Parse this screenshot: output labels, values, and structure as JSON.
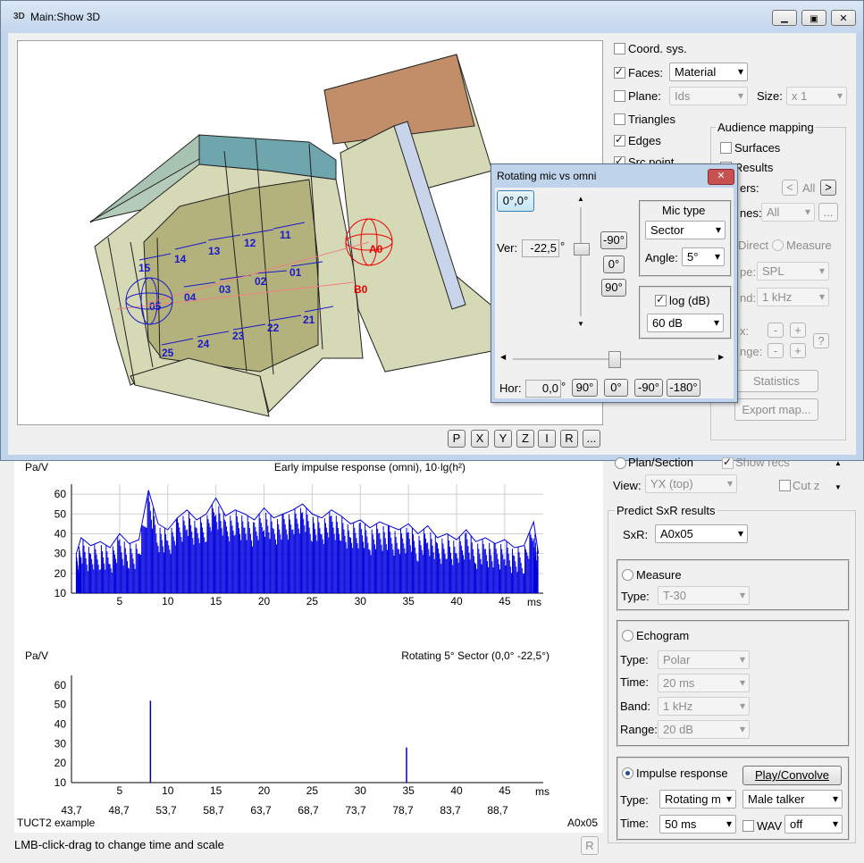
{
  "window": {
    "title": "Main:Show 3D",
    "icon": "3D"
  },
  "right_panel": {
    "coord_sys": "Coord. sys.",
    "faces": "Faces:",
    "faces_value": "Material",
    "plane": "Plane:",
    "plane_value": "Ids",
    "size": "Size:",
    "size_value": "x 1",
    "triangles": "Triangles",
    "edges": "Edges",
    "src_point_partial": "Src.point",
    "audience_mapping": {
      "title": "Audience mapping",
      "surfaces": "Surfaces",
      "results": "Results",
      "filters_partial": "ers:",
      "all_btn": "All",
      "prev_btn": "<",
      "next_btn": ">",
      "planes_partial": "nes:",
      "planes_value": "All",
      "more_btn": "...",
      "direct": "Direct",
      "measure": "Measure",
      "type_partial": "pe:",
      "type_value": "SPL",
      "band_partial": "nd:",
      "band_value": "1 kHz",
      "max_partial": "x:",
      "range_partial": "nge:",
      "minus": "-",
      "plus": "+",
      "help": "?",
      "statistics": "Statistics",
      "export_map": "Export map..."
    }
  },
  "view_buttons": [
    "P",
    "X",
    "Y",
    "Z",
    "I",
    "R",
    "..."
  ],
  "dialog": {
    "title": "Rotating mic vs omni",
    "reset_btn": "0°,0°",
    "ver_label": "Ver:",
    "ver_value": "-22,5",
    "deg": "°",
    "ver_buttons": [
      "-90°",
      "0°",
      "90°"
    ],
    "mic_type_title": "Mic type",
    "mic_type_value": "Sector",
    "angle_label": "Angle:",
    "angle_value": "5°",
    "log_label": "log (dB)",
    "log_value": "60 dB",
    "hor_label": "Hor:",
    "hor_value": "0,0",
    "hor_buttons": [
      "90°",
      "0°",
      "-90°",
      "-180°"
    ]
  },
  "view_panel": {
    "plan_section": "Plan/Section",
    "show_recs": "Show recs",
    "view_label": "View:",
    "view_value": "YX (top)",
    "cut_z": "Cut z"
  },
  "predict": {
    "title": "Predict SxR results",
    "sxr_label": "SxR:",
    "sxr_value": "A0x05",
    "measure": "Measure",
    "measure_type_label": "Type:",
    "measure_type_value": "T-30",
    "echogram": "Echogram",
    "echo_type_label": "Type:",
    "echo_type_value": "Polar",
    "echo_time_label": "Time:",
    "echo_time_value": "20 ms",
    "echo_band_label": "Band:",
    "echo_band_value": "1 kHz",
    "echo_range_label": "Range:",
    "echo_range_value": "20 dB",
    "impulse": "Impulse response",
    "play_convolve": "Play/Convolve",
    "ir_type_label": "Type:",
    "ir_type_value": "Rotating m",
    "talker_value": "Male talker",
    "ir_time_label": "Time:",
    "ir_time_value": "50 ms",
    "wav_label": "WAV",
    "wav_value": "off"
  },
  "model_labels": [
    "15",
    "14",
    "13",
    "12",
    "11",
    "04",
    "03",
    "02",
    "01",
    "05",
    "25",
    "24",
    "23",
    "22",
    "21",
    "A0",
    "B0"
  ],
  "chart_data": [
    {
      "type": "line",
      "title": "Early impulse response  (omni), 10·lg(h²)",
      "ylabel": "Pa/V",
      "xlabel": "ms",
      "xlim": [
        0,
        49
      ],
      "ylim": [
        10,
        65
      ],
      "xticks": [
        5,
        10,
        15,
        20,
        25,
        30,
        35,
        40,
        45
      ],
      "yticks": [
        10,
        20,
        30,
        40,
        50,
        60
      ],
      "grid": true,
      "color": "#0000dd",
      "series": [
        {
          "x": [
            0.5,
            1,
            2,
            3,
            4,
            5,
            6,
            7,
            8,
            9,
            10,
            11,
            12,
            13,
            14,
            15,
            16,
            17,
            18,
            19,
            20,
            21,
            22,
            23,
            24,
            25,
            26,
            27,
            28,
            29,
            30,
            31,
            32,
            33,
            34,
            35,
            36,
            37,
            38,
            39,
            40,
            41,
            42,
            43,
            44,
            45,
            46,
            47,
            48,
            48.5
          ],
          "y": [
            30,
            38,
            34,
            36,
            33,
            40,
            35,
            37,
            62,
            45,
            42,
            48,
            52,
            47,
            50,
            58,
            49,
            52,
            50,
            47,
            53,
            48,
            50,
            52,
            55,
            50,
            48,
            52,
            49,
            45,
            47,
            43,
            46,
            44,
            42,
            45,
            40,
            44,
            38,
            40,
            37,
            42,
            36,
            38,
            35,
            37,
            33,
            34,
            46,
            30
          ]
        }
      ]
    },
    {
      "type": "bar",
      "title": "Rotating 5° Sector (0,0° -22,5°)",
      "ylabel": "Pa/V",
      "xlabel": "ms",
      "xlim": [
        0,
        49
      ],
      "ylim": [
        10,
        65
      ],
      "xticks": [
        5,
        10,
        15,
        20,
        25,
        30,
        35,
        40,
        45
      ],
      "yticks": [
        10,
        20,
        30,
        40,
        50,
        60
      ],
      "grid": false,
      "color": "#0000aa",
      "x": [
        8.2,
        34.8
      ],
      "values": [
        52,
        28
      ],
      "time_axis": [
        "43,7",
        "48,7",
        "53,7",
        "58,7",
        "63,7",
        "68,7",
        "73,7",
        "78,7",
        "83,7",
        "88,7"
      ],
      "footer_left": "TUCT2 example",
      "footer_right": "A0x05"
    }
  ],
  "status": {
    "text": "LMB-click-drag to change time and scale",
    "r_btn": "R"
  }
}
